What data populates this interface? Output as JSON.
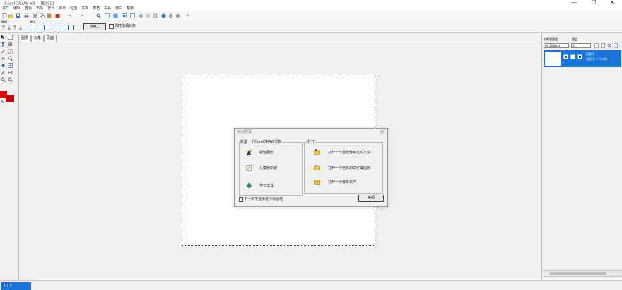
{
  "window": {
    "title": "CorelDRAW X4 - [图形1]",
    "minimize_glyph": "—",
    "maximize_glyph": "☐",
    "close_glyph": "✕"
  },
  "menu": [
    "文件",
    "编辑",
    "查看",
    "布局",
    "排列",
    "效果",
    "位图",
    "文本",
    "表格",
    "工具",
    "窗口",
    "帮助"
  ],
  "property_bar": {
    "label_top": "微调",
    "label_mid": "单位",
    "apply_button": "应用...",
    "checkbox_label": "同时微调对象"
  },
  "doc_tabs": [
    "图层",
    "对象",
    "页面"
  ],
  "dialog": {
    "title": "欢迎屏幕",
    "close_glyph": "✕",
    "left_group_label": "新建一个CorelDRAW文档",
    "left_items": [
      "新建图形",
      "从模板新建"
    ],
    "tutorial_item": "学习工具",
    "right_group_label": "打开",
    "right_items": [
      "打开一个最近使用过的文件",
      "打开一个已有的文件或图形",
      "打开一个样本文件"
    ],
    "checkbox_label": "下一次不显示这个对话框",
    "close_button": "关闭"
  },
  "object_manager": {
    "label_left": "对象管理器",
    "label_right": "图层",
    "combo_value": "All Objects",
    "combo2_value": "1",
    "page_item_title": "页面 1",
    "page_item_sub": "图层 1, 0 个对象"
  },
  "status": {
    "left": "1 / 1"
  },
  "colors": {
    "accent": "#1a73d9",
    "fill_swatch": "#e00000",
    "outline_swatch": "#c80000"
  }
}
